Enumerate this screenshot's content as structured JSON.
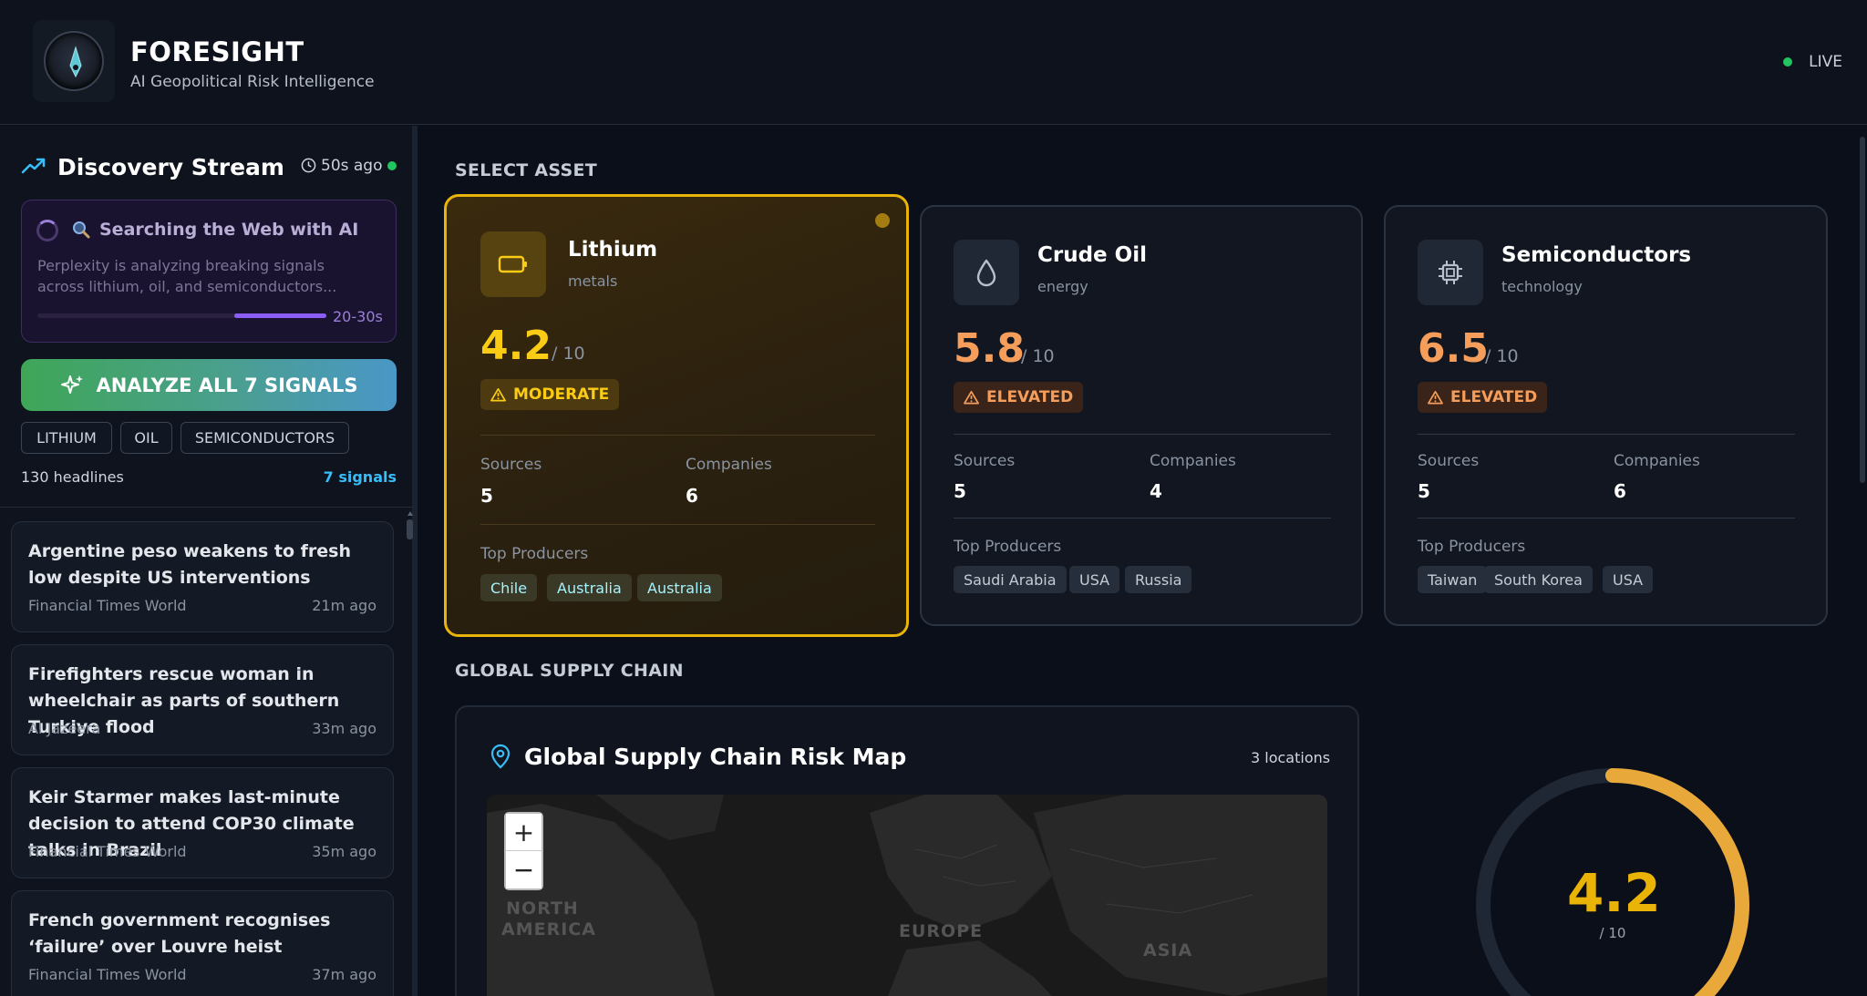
{
  "header": {
    "brand_title": "FORESIGHT",
    "brand_subtitle": "AI Geopolitical Risk Intelligence",
    "live_label": "LIVE",
    "logo_icon": "compass-logo-icon"
  },
  "sidebar": {
    "title": "Discovery Stream",
    "title_icon": "trending-up-icon",
    "updated": "50s ago",
    "search": {
      "title": "Searching the Web with AI",
      "description": "Perplexity is analyzing breaking signals across lithium, oil, and semiconductors...",
      "eta": "20-30s",
      "progress": 0.32
    },
    "analyze_button": "ANALYZE ALL 7 SIGNALS",
    "chips": [
      "LITHIUM",
      "OIL",
      "SEMICONDUCTORS"
    ],
    "headlines": "130 headlines",
    "signals": "7 signals",
    "news": [
      {
        "title": "Argentine peso weakens to fresh low despite US interventions",
        "source": "Financial Times World",
        "time": "21m ago"
      },
      {
        "title": "Firefighters rescue woman in wheelchair as parts of southern Turkiye flood",
        "source": "Al Jazeera",
        "time": "33m ago"
      },
      {
        "title": "Keir Starmer makes last-minute decision to attend COP30 climate talks in Brazil",
        "source": "Financial Times World",
        "time": "35m ago"
      },
      {
        "title": "French government recognises ‘failure’ over Louvre heist",
        "source": "Financial Times World",
        "time": "37m ago"
      }
    ]
  },
  "main": {
    "select_asset_label": "SELECT ASSET",
    "assets": [
      {
        "name": "Lithium",
        "category": "metals",
        "score": "4.2",
        "max": "/ 10",
        "level": "MODERATE",
        "sources_label": "Sources",
        "sources": "5",
        "companies_label": "Companies",
        "companies": "6",
        "producers_label": "Top Producers",
        "producers": [
          "Chile",
          "Australia",
          "Australia"
        ],
        "icon": "battery-icon",
        "color": "#facc15"
      },
      {
        "name": "Crude Oil",
        "category": "energy",
        "score": "5.8",
        "max": "/ 10",
        "level": "ELEVATED",
        "sources_label": "Sources",
        "sources": "5",
        "companies_label": "Companies",
        "companies": "4",
        "producers_label": "Top Producers",
        "producers": [
          "Saudi Arabia",
          "USA",
          "Russia"
        ],
        "icon": "droplet-icon",
        "color": "#f59e5b"
      },
      {
        "name": "Semiconductors",
        "category": "technology",
        "score": "6.5",
        "max": "/ 10",
        "level": "ELEVATED",
        "sources_label": "Sources",
        "sources": "5",
        "companies_label": "Companies",
        "companies": "6",
        "producers_label": "Top Producers",
        "producers": [
          "Taiwan",
          "South Korea",
          "USA"
        ],
        "icon": "chip-icon",
        "color": "#f59e5b"
      }
    ],
    "supply_chain_label": "GLOBAL SUPPLY CHAIN",
    "map": {
      "title": "Global Supply Chain Risk Map",
      "locations": "3 locations",
      "zoom_in": "+",
      "zoom_out": "−",
      "labels": [
        "NORTH AMERICA",
        "EUROPE",
        "ASIA"
      ]
    },
    "gauge": {
      "value": "4.2",
      "max": "/ 10",
      "fraction": 0.42,
      "color": "#eab308"
    }
  }
}
